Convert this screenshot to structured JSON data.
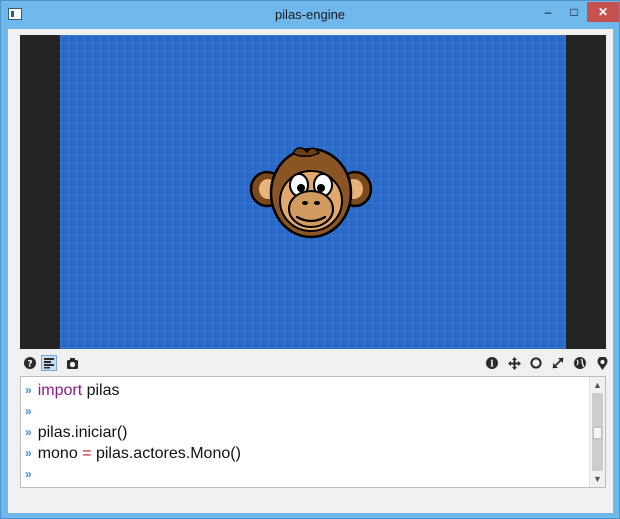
{
  "window": {
    "title": "pilas-engine",
    "controls": {
      "minimize": "–",
      "maximize": "□",
      "close": "✕"
    }
  },
  "toolbar": {
    "left_icons": [
      "help-icon",
      "editor-icon",
      "screenshot-icon"
    ],
    "right_icons": [
      "info-icon",
      "move-icon",
      "circle-icon",
      "resize-icon",
      "globe-icon",
      "position-icon"
    ]
  },
  "console": {
    "prompt": "»",
    "lines": [
      {
        "tokens": [
          {
            "text": "import",
            "kind": "keyword"
          },
          {
            "text": " pilas",
            "kind": "plain"
          }
        ]
      },
      {
        "tokens": []
      },
      {
        "tokens": [
          {
            "text": "pilas.iniciar()",
            "kind": "plain"
          }
        ]
      },
      {
        "tokens": [
          {
            "text": "mono ",
            "kind": "plain"
          },
          {
            "text": "=",
            "kind": "operator"
          },
          {
            "text": " pilas.actores.Mono()",
            "kind": "plain"
          }
        ]
      },
      {
        "tokens": []
      }
    ]
  },
  "colors": {
    "stage_background": "#2869c9",
    "canvas_border": "#242424",
    "keyword": "#8a1a8a",
    "operator": "#c02020",
    "prompt": "#3a8fe0",
    "titlebar": "#6fb8ec"
  },
  "stage": {
    "actor": "monkey"
  }
}
